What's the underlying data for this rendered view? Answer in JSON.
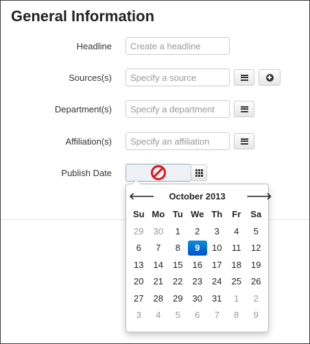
{
  "section": {
    "title": "General Information"
  },
  "form": {
    "headline": {
      "label": "Headline",
      "placeholder": "Create a headline"
    },
    "sources": {
      "label": "Sources(s)",
      "placeholder": "Specify a source"
    },
    "department": {
      "label": "Department(s)",
      "placeholder": "Specify a department"
    },
    "affiliation": {
      "label": "Affiliation(s)",
      "placeholder": "Specify an affiliation"
    },
    "publish_date": {
      "label": "Publish Date"
    }
  },
  "icons": {
    "list": "list-icon",
    "add": "plus-circle-icon",
    "calendar": "grid-calendar-icon",
    "disabled": "not-allowed-icon"
  },
  "datepicker": {
    "prev": "🡐",
    "next": "🡒",
    "month_label": "October 2013",
    "weekdays": [
      "Su",
      "Mo",
      "Tu",
      "We",
      "Th",
      "Fr",
      "Sa"
    ],
    "weeks": [
      [
        "29",
        "30",
        "1",
        "2",
        "3",
        "4",
        "5"
      ],
      [
        "6",
        "7",
        "8",
        "9",
        "10",
        "11",
        "12"
      ],
      [
        "13",
        "14",
        "15",
        "16",
        "17",
        "18",
        "19"
      ],
      [
        "20",
        "21",
        "22",
        "23",
        "24",
        "25",
        "26"
      ],
      [
        "27",
        "28",
        "29",
        "30",
        "31",
        "1",
        "2"
      ],
      [
        "3",
        "4",
        "5",
        "6",
        "7",
        "8",
        "9"
      ]
    ],
    "selected_day": "9",
    "colors": {
      "selected": "#0a6fd6",
      "muted_day": "#999999",
      "disabled_icon": "#e0131b"
    }
  }
}
